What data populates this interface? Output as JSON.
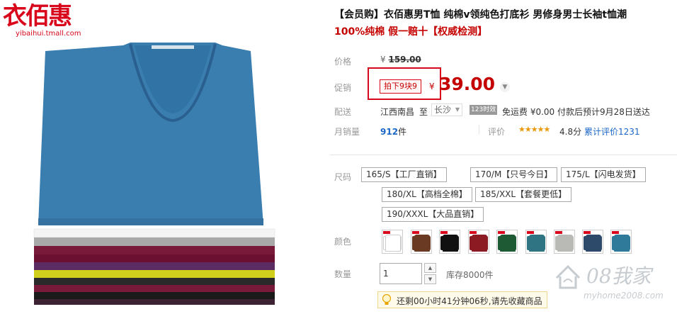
{
  "store": {
    "logo_text": "衣佰惠",
    "logo_url": "yibaihui.tmall.com"
  },
  "product": {
    "title": "【会员购】衣佰惠男T恤 纯棉v领纯色打底衫 男修身男士长袖t恤潮",
    "subtitle": "100%纯棉 假一赔十【权威检测】",
    "colors_main": "#3a7eb0"
  },
  "price": {
    "label": "价格",
    "currency": "¥",
    "original": "159.00"
  },
  "promo": {
    "label": "促销",
    "tag": "拍下9块9",
    "currency": "¥",
    "price": "39.00",
    "accent": "#c40000"
  },
  "shipping": {
    "label": "配送",
    "from": "江西南昌",
    "to_label": "至",
    "to_city": "长沙",
    "badge_num": "123",
    "badge_text": "时效",
    "info": "免运费 ¥0.00 付款后预计9月28日送达"
  },
  "sales": {
    "label": "月销量",
    "count": "912",
    "unit": "件",
    "rating_label": "评价",
    "stars": "★★★★★",
    "score": "4.8分",
    "total_reviews": "累计评价1231"
  },
  "sizes": {
    "label": "尺码",
    "options": [
      "165/S【工厂直销】",
      "170/M【只号今日】",
      "175/L【闪电发货】",
      "180/XL【高档全棉】",
      "185/XXL【套餐更低】",
      "190/XXXL【大品直销】"
    ]
  },
  "colors": {
    "label": "颜色",
    "swatches": [
      "#ffffff",
      "#6b3a22",
      "#111111",
      "#8c1a22",
      "#1e5a34",
      "#2f7482",
      "#b9b9b5",
      "#2e4a6b",
      "#2f7a9b"
    ]
  },
  "quantity": {
    "label": "数量",
    "value": "1",
    "stock": "库存8000件"
  },
  "notice": {
    "text": "还剩00小时41分钟06秒,请先收藏商品"
  },
  "watermark": {
    "logo": "08我家",
    "url": "myhome2008.com"
  }
}
